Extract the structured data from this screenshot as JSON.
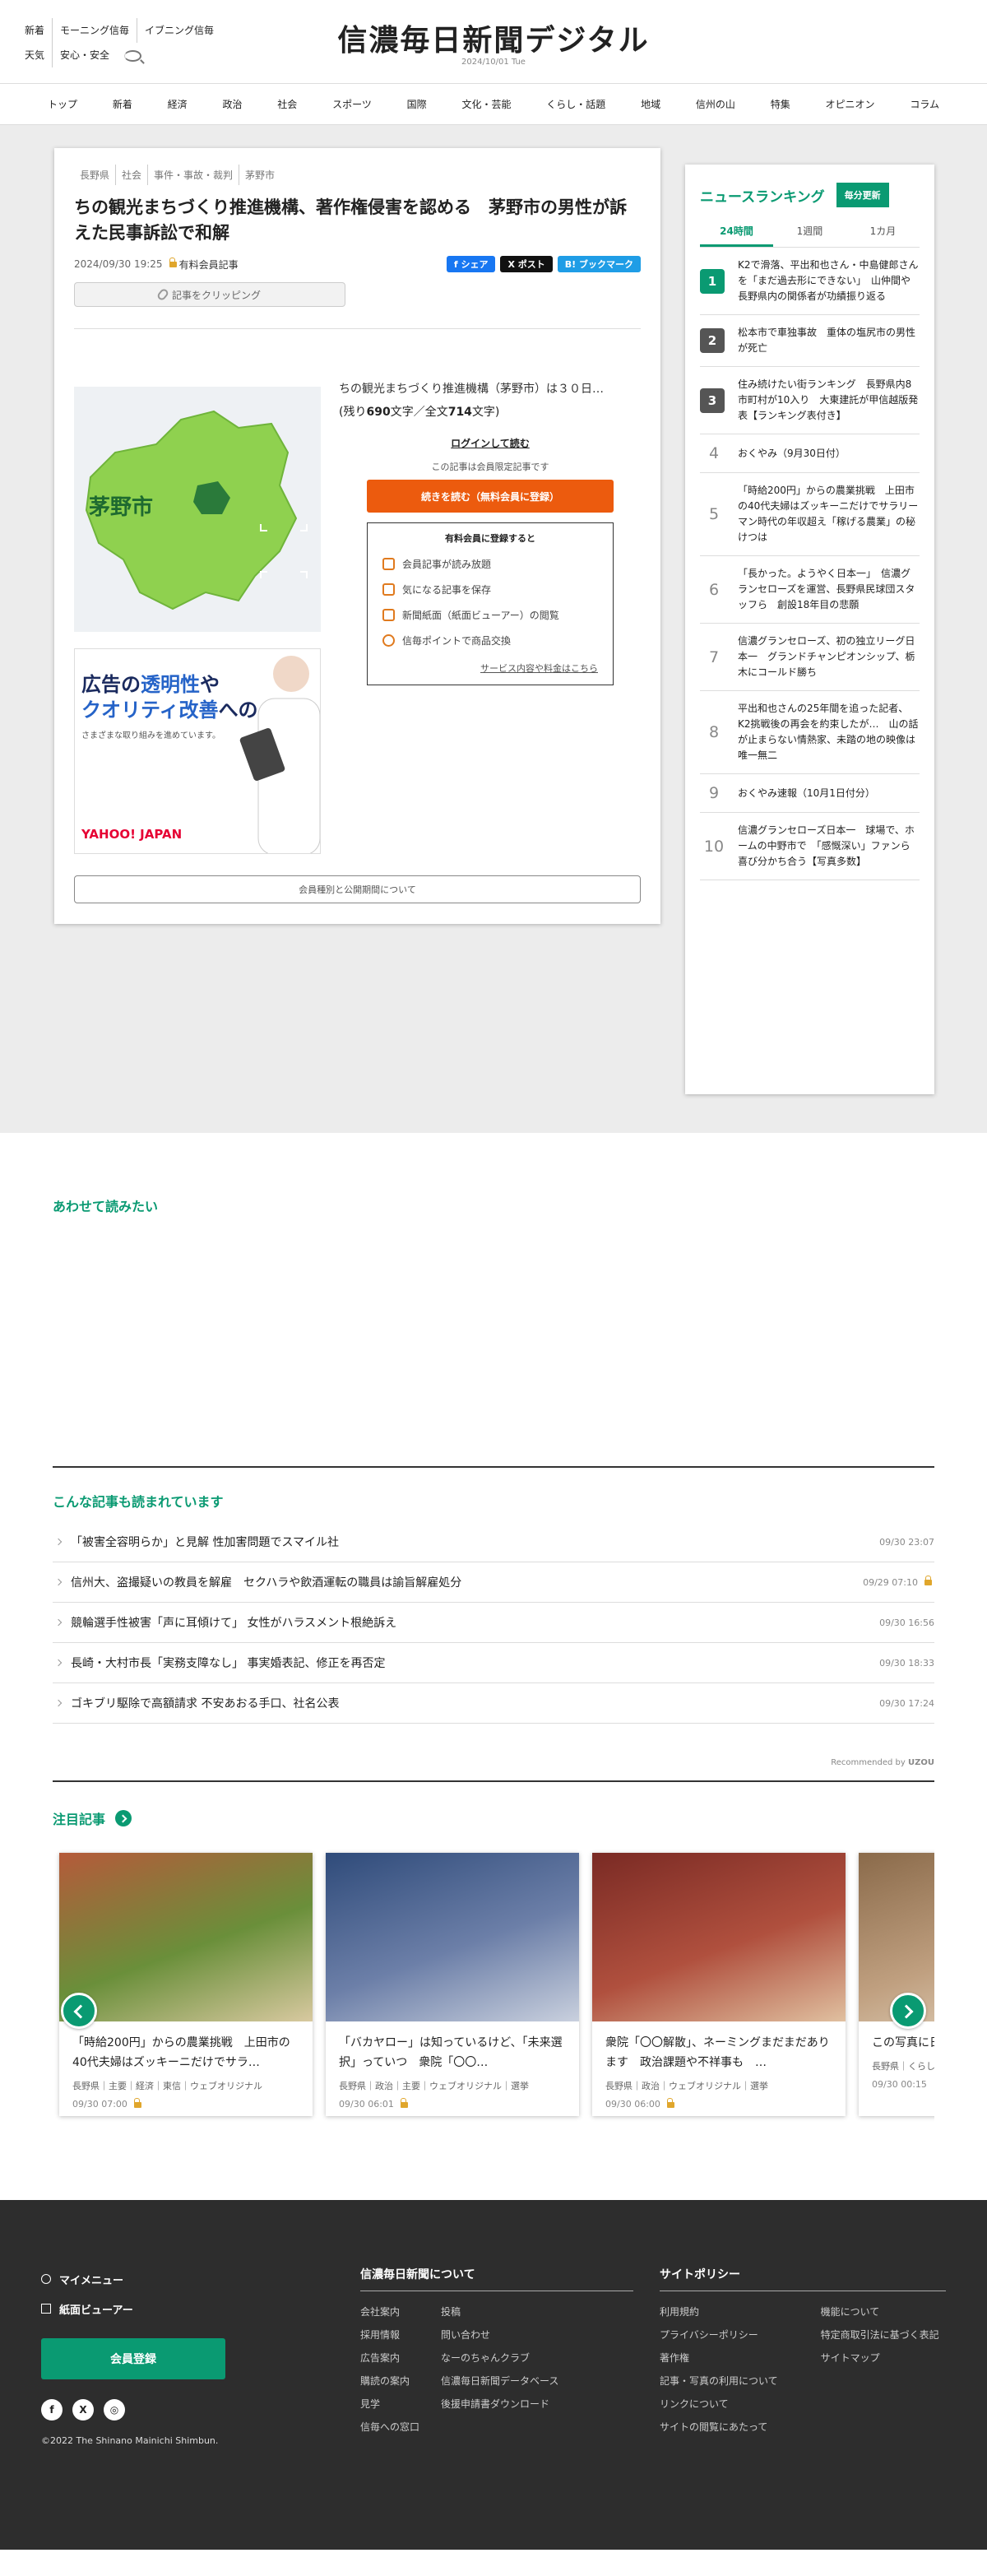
{
  "header": {
    "row1": [
      "新着",
      "モーニング信毎",
      "イブニング信毎"
    ],
    "row2": [
      "天気",
      "安心・安全"
    ],
    "logo": "信濃毎日新聞デジタル",
    "date": "2024/10/01 Tue"
  },
  "nav": [
    "トップ",
    "新着",
    "経済",
    "政治",
    "社会",
    "スポーツ",
    "国際",
    "文化・芸能",
    "くらし・話題",
    "地域",
    "信州の山",
    "特集",
    "オピニオン",
    "コラム"
  ],
  "article": {
    "breadcrumb": [
      "長野県",
      "社会",
      "事件・事故・裁判",
      "茅野市"
    ],
    "title": "ちの観光まちづくり推進機構、著作権侵害を認める　茅野市の男性が訴えた民事訴訟で和解",
    "datetime": "2024/09/30 19:25",
    "member_label": "有料会員記事",
    "share": [
      "シェア",
      "ポスト",
      "ブックマーク"
    ],
    "clip_label": "記事をクリッピング",
    "map_label": "茅野市",
    "lead": "ちの観光まちづくり推進機構（茅野市）は３０日…",
    "remain_prefix": "(残り",
    "remain_chars": "690",
    "remain_mid": "文字／全文",
    "total_chars": "714",
    "remain_suffix": "文字)",
    "login_label": "ログインして読む",
    "limited_note": "この記事は会員限定記事です",
    "cta_label": "続きを読む（無料会員に登録）",
    "benefits_title": "有料会員に登録すると",
    "benefits": [
      "会員記事が読み放題",
      "気になる記事を保存",
      "新聞紙面（紙面ビューアー）の閲覧",
      "信毎ポイントで商品交換"
    ],
    "benefits_link": "サービス内容や料金はこちら",
    "pub_label": "会員種別と公開期間について",
    "ad": {
      "line1_a": "広告",
      "line1_b": "の",
      "line1_c": "透明性",
      "line1_d": "や",
      "line2_a": "クオリティ改善",
      "line2_b": "への",
      "sub": "さまざまな取り組みを進めています。",
      "brand": "YAHOO! JAPAN"
    }
  },
  "ranking": {
    "title": "ニュースランキング",
    "badge": "毎分更新",
    "tabs": [
      "24時間",
      "1週間",
      "1カ月"
    ],
    "items": [
      {
        "num": "1",
        "text": "K2で滑落、平出和也さん・中島健郎さんを「まだ過去形にできない」　山仲間や長野県内の関係者が功績振り返る"
      },
      {
        "num": "2",
        "text": "松本市で車独事故　重体の塩尻市の男性が死亡"
      },
      {
        "num": "3",
        "text": "住み続けたい街ランキング　長野県内8市町村が10入り　大東建託が甲信越版発表【ランキング表付き】"
      },
      {
        "num": "4",
        "text": "おくやみ（9月30日付）"
      },
      {
        "num": "5",
        "text": "「時給200円」からの農業挑戦　上田市の40代夫婦はズッキーニだけでサラリーマン時代の年収超え「稼げる農業」の秘けつは"
      },
      {
        "num": "6",
        "text": "「長かった。ようやく日本一」　信濃グランセローズを運営、長野県民球団スタッフら　創設18年目の悲願"
      },
      {
        "num": "7",
        "text": "信濃グランセローズ、初の独立リーグ日本一　グランドチャンピオンシップ、栃木にコールド勝ち"
      },
      {
        "num": "8",
        "text": "平出和也さんの25年間を追った記者、K2挑戦後の再会を約束したが…　山の話が止まらない情熱家、未踏の地の映像は唯一無二"
      },
      {
        "num": "9",
        "text": "おくやみ速報（10月1日付分）"
      },
      {
        "num": "10",
        "text": "信濃グランセローズ日本一　球場で、ホームの中野市で　「感慨深い」ファンら喜び分かち合う【写真多数】"
      }
    ]
  },
  "related": {
    "title": "あわせて読みたい"
  },
  "recommended": {
    "title": "こんな記事も読まれています",
    "items": [
      {
        "title": "「被害全容明らか」と見解 性加害問題でスマイル社",
        "date": "09/30 23:07",
        "lock": false
      },
      {
        "title": "信州大、盗撮疑いの教員を解雇　セクハラや飲酒運転の職員は諭旨解雇処分",
        "date": "09/29 07:10",
        "lock": true
      },
      {
        "title": "競輪選手性被害「声に耳傾けて」 女性がハラスメント根絶訴え",
        "date": "09/30 16:56",
        "lock": false
      },
      {
        "title": "長崎・大村市長「実務支障なし」 事実婚表記、修正を再否定",
        "date": "09/30 18:33",
        "lock": false
      },
      {
        "title": "ゴキブリ駆除で高額請求 不安あおる手口、社名公表",
        "date": "09/30 17:24",
        "lock": false
      }
    ],
    "powered": "Recommended by",
    "powered_brand": "UZOU"
  },
  "featured": {
    "title": "注目記事",
    "cards": [
      {
        "title": "「時給200円」からの農業挑戦　上田市の40代夫婦はズッキーニだけでサラ…",
        "tags": "長野県｜主要｜経済｜東信｜ウェブオリジナル",
        "date": "09/30 07:00",
        "lock": true
      },
      {
        "title": "「バカヤロー」は知っているけど、「未来選択」っていつ　衆院「〇〇…",
        "tags": "長野県｜政治｜主要｜ウェブオリジナル｜選挙",
        "date": "09/30 06:01",
        "lock": true
      },
      {
        "title": "衆院「〇〇解散」、ネーミングまだまだあります　政治課題や不祥事も　…",
        "tags": "長野県｜政治｜ウェブオリジナル｜選挙",
        "date": "09/30 06:00",
        "lock": true
      },
      {
        "title": "この写真に日のこと駒…",
        "tags": "長野県｜くらし",
        "date": "09/30 00:15",
        "lock": false
      }
    ]
  },
  "footer": {
    "my_menu": "マイメニュー",
    "viewer": "紙面ビューアー",
    "signup": "会員登録",
    "socials": [
      "f",
      "X",
      "◎"
    ],
    "copyright": "©2022 The Shinano Mainichi Shimbun.",
    "about_title": "信濃毎日新聞について",
    "about_col1": [
      "会社案内",
      "採用情報",
      "広告案内",
      "購読の案内",
      "見学",
      "信毎への窓口"
    ],
    "about_col2": [
      "投稿",
      "問い合わせ",
      "なーのちゃんクラブ",
      "信濃毎日新聞データベース",
      "後援申請書ダウンロード"
    ],
    "policy_title": "サイトポリシー",
    "policy_col1": [
      "利用規約",
      "プライバシーポリシー",
      "著作権",
      "記事・写真の利用について",
      "リンクについて",
      "サイトの閲覧にあたって"
    ],
    "policy_col2": [
      "機能について",
      "特定商取引法に基づく表記",
      "サイトマップ"
    ]
  }
}
